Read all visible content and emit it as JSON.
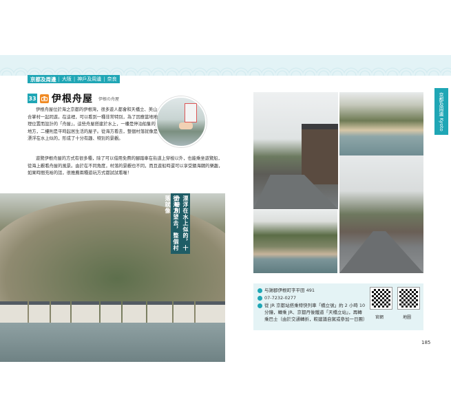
{
  "breadcrumb": {
    "main": "京都及周邊",
    "items": [
      "大阪",
      "神戶及周邊",
      "奈良"
    ]
  },
  "section": {
    "number": "33",
    "title": "伊根舟屋",
    "subtitle": "伊根の舟屋"
  },
  "paragraphs": [
    "伊根舟屋位於海之京都的伊根灣，很多遊人都會和天橋立、美山合掌村一起同遊。在這裡，可以看到一種非常特別，為了因應當地地理位置而設計的「舟屋」，這些舟屋搭建於水上，一樓是停泊船隻的地方，二樓則是平時起居生活的屋子。從海方看去，整個村落就像是漂浮在水上似的，形成了十分有趣、特別的景觀。",
    "遊覽伊根舟屋的方式有很多種，除了可以借用免費的腳踏車在街道上穿梭以外，也能乘坐遊覽船，從海上觀看舟屋的風景。由於在不同角度，村落的景觀也不同，而且遊船時還可以享受餵海鷗的樂趣，如果時間充裕的話，很推薦兩種遊玩方式都試試看喔！"
  ],
  "caption_lines": [
    "從海方望去，整個村落就像",
    "漂浮在水上似的，十分特別"
  ],
  "side_tab": "京都及周邊 Kyoto",
  "info": {
    "address": "与謝郡伊根町字平田 491",
    "phone": "07-7232-0277",
    "access": "從 JR 京都站搭乘特快列車「橋立號」約 2 小時 10 分鐘，轉乘 JR、京都丹後鐵道「天橋立站」，再轉乘巴士（由於交通轉折，較建議自駕或參加一日團）"
  },
  "qr_labels": [
    "官網",
    "地圖"
  ],
  "page_number": "185",
  "colors": {
    "accent": "#1fa6b5",
    "caption_bg": "#1f5d66",
    "info_bg": "#e4f3f5"
  }
}
